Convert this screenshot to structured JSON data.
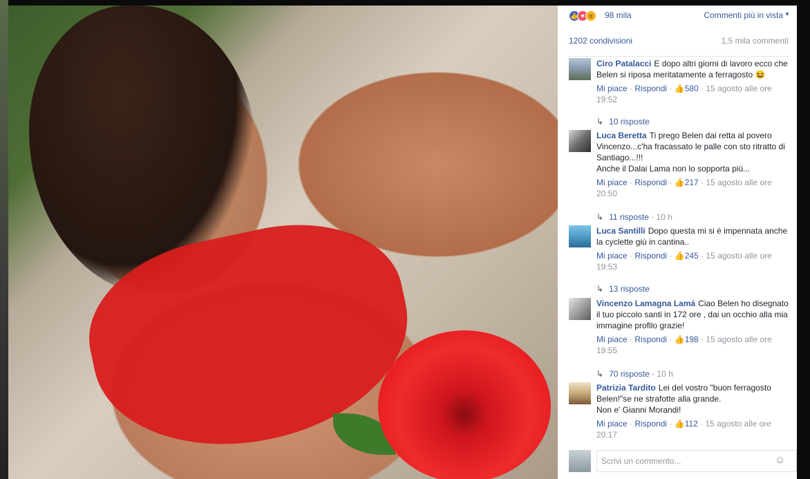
{
  "reactions": {
    "icons": [
      "like-icon",
      "love-icon",
      "wow-icon"
    ],
    "count": "98 mila"
  },
  "sort": {
    "label": "Commenti più in vista"
  },
  "stats": {
    "shares": "1202 condivisioni",
    "comments": "1,5 mila commenti"
  },
  "comments": [
    {
      "author": "Ciro Patalacci",
      "text": "E dopo altri giorni di lavoro ecco che Belen si riposa meritatamente a ferragosto 😆",
      "like": "Mi piace",
      "reply": "Rispondi",
      "likes": "580",
      "time": "15 agosto alle ore 19:52",
      "replies": "10 risposte",
      "replies_time": ""
    },
    {
      "author": "Luca Beretta",
      "text": "Ti prego Belen dai retta al povero Vincenzo...c'ha fracassato le palle con sto ritratto di Santiago...!!!",
      "text2": "Anche il Dalai Lama non lo sopporta più...",
      "like": "Mi piace",
      "reply": "Rispondi",
      "likes": "217",
      "time": "15 agosto alle ore 20:50",
      "replies": "11 risposte",
      "replies_time": "10 h"
    },
    {
      "author": "Luca Santilli",
      "text": "Dopo questa mi si è impennata anche la cyclette giù in cantina..",
      "like": "Mi piace",
      "reply": "Rispondi",
      "likes": "245",
      "time": "15 agosto alle ore 19:53",
      "replies": "13 risposte",
      "replies_time": ""
    },
    {
      "author": "Vincenzo Lamagna Lamá",
      "text": "Ciao Belen ho disegnato il tuo piccolo santi in 172 ore , dai un occhio alla mia immagine profilo grazie!",
      "like": "Mi piace",
      "reply": "Rispondi",
      "likes": "198",
      "time": "15 agosto alle ore 19:55",
      "replies": "70 risposte",
      "replies_time": "10 h"
    },
    {
      "author": "Patrizia Tardito",
      "text": "Lei del vostro \"buon ferragosto Belen!\"se ne strafotte alla grande.",
      "text2": "Non e' Gianni Morandi!",
      "like": "Mi piace",
      "reply": "Rispondi",
      "likes": "112",
      "time": "15 agosto alle ore 20:17"
    }
  ],
  "composer": {
    "placeholder": "Scrivi un commento..."
  },
  "colors": {
    "link": "#365899",
    "meta": "#90949c",
    "text": "#1d2129"
  }
}
